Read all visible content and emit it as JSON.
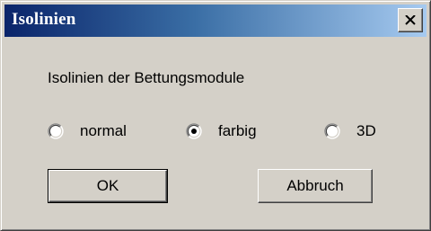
{
  "dialog": {
    "title": "Isolinien",
    "prompt": "Isolinien der Bettungsmodule",
    "options": [
      {
        "label": "normal",
        "selected": false
      },
      {
        "label": "farbig",
        "selected": true
      },
      {
        "label": "3D",
        "selected": false
      }
    ],
    "ok_label": "OK",
    "cancel_label": "Abbruch"
  },
  "colors": {
    "titlebar_start": "#0a246a",
    "titlebar_end": "#a6caf0",
    "face": "#d4d0c8"
  },
  "icons": {
    "close": "close-icon"
  }
}
